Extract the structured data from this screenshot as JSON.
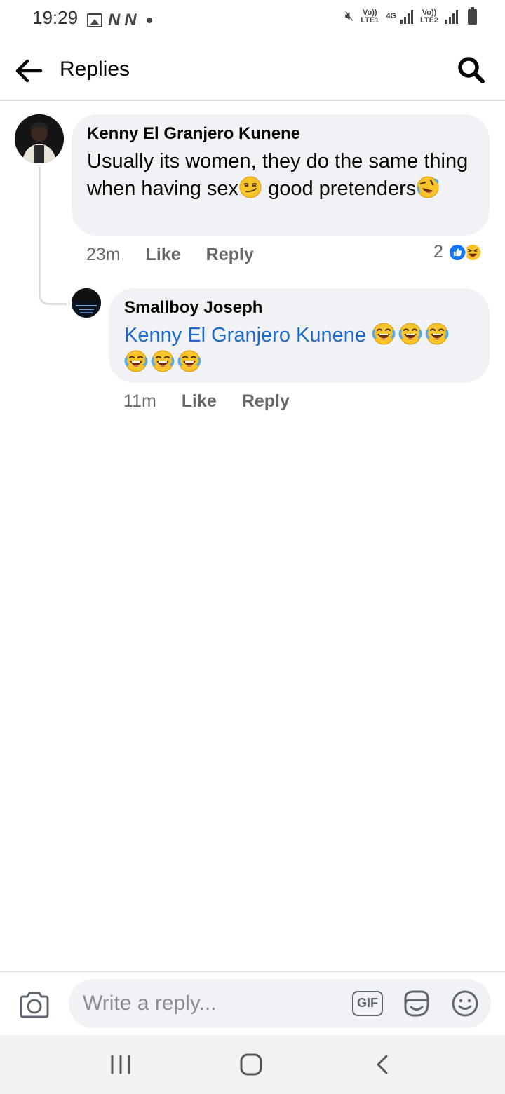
{
  "status_bar": {
    "time": "19:29",
    "lte1_label": "Vo)) LTE1",
    "net_label": "4G",
    "lte2_label": "Vo)) LTE2"
  },
  "header": {
    "title": "Replies",
    "back_icon": "arrow-left-icon",
    "search_icon": "search-icon"
  },
  "comments": [
    {
      "author": "Kenny El Granjero Kunene",
      "text_part1": "Usually its women, they do the same thing when having sex",
      "text_part2": " good pretenders",
      "emojis": [
        "smirk-emoji",
        "rolling-laughing-emoji"
      ],
      "time": "23m",
      "like_label": "Like",
      "reply_label": "Reply",
      "reaction_count": "2",
      "reaction_icons": [
        "like-reaction-icon",
        "haha-reaction-icon"
      ]
    },
    {
      "author": "Smallboy Joseph",
      "mention": "Kenny El Granjero Kunene",
      "emojis": [
        "tears-of-joy-emoji",
        "tears-of-joy-emoji",
        "tears-of-joy-emoji",
        "tears-of-joy-emoji",
        "tears-of-joy-emoji",
        "tears-of-joy-emoji"
      ],
      "time": "11m",
      "like_label": "Like",
      "reply_label": "Reply"
    }
  ],
  "composer": {
    "placeholder": "Write a reply...",
    "gif_label": "GIF"
  },
  "colors": {
    "mention": "#1b6ac9",
    "bubble": "#f0f2f5",
    "secondary_text": "#65676b",
    "like_blue": "#1877f2",
    "emoji_yellow": "#f7c42a"
  }
}
